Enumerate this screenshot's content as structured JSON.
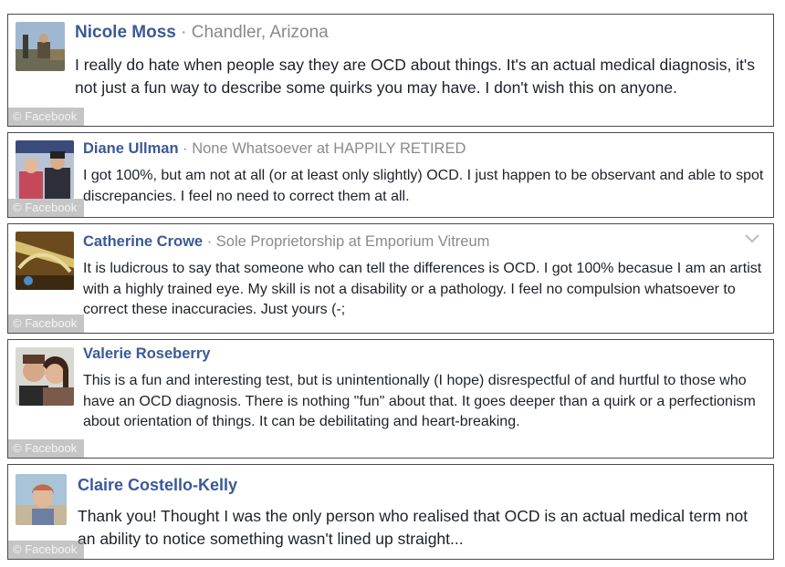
{
  "watermark": "© Facebook",
  "comments": [
    {
      "name": "Nicole Moss",
      "meta": "· Chandler, Arizona",
      "text": "I really do hate when people say they are OCD about things. It's an actual medical diagnosis, it's not just a fun way to describe some quirks you may have. I don't wish this on anyone."
    },
    {
      "name": "Diane Ullman",
      "meta": "· None Whatsoever at HAPPILY RETIRED",
      "text": "I got 100%, but am not at all (or at least only slightly) OCD. I just happen to be observant and able to spot discrepancies. I feel no need to correct them at all."
    },
    {
      "name": "Catherine Crowe",
      "meta": "· Sole Proprietorship at Emporium Vitreum",
      "text": "It is ludicrous to say that someone who can tell the differences is OCD. I got 100% becasue I am an artist with a highly trained eye. My skill is not a disability or a pathology. I feel no compulsion whatsoever to correct these inaccuracies. Just yours (-;"
    },
    {
      "name": "Valerie Roseberry",
      "meta": "",
      "text": "This is a fun and interesting test, but is unintentionally (I hope) disrespectful of and hurtful to those who have an OCD diagnosis. There is nothing \"fun\" about that. It goes deeper than a quirk or a perfectionism about orientation of things. It can be debilitating and heart-breaking."
    },
    {
      "name": "Claire Costello-Kelly",
      "meta": "",
      "text": "Thank you! Thought I was the only person who realised that OCD is an actual medical term not an ability to notice something wasn't lined up straight..."
    }
  ],
  "icons": {
    "options": "chevron-down-icon"
  }
}
